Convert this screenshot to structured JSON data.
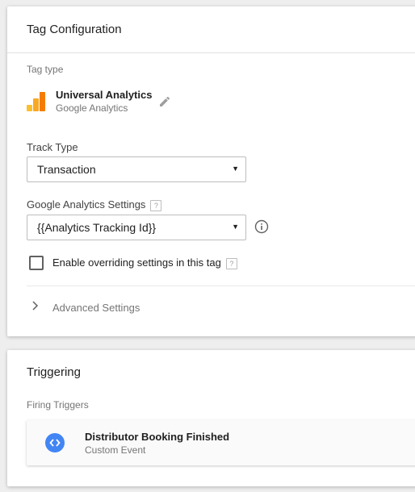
{
  "tag_config": {
    "title": "Tag Configuration",
    "tag_type_label": "Tag type",
    "tag_type": {
      "name": "Universal Analytics",
      "vendor": "Google Analytics",
      "icon": "google-analytics-logo-icon",
      "edit_icon": "pencil-icon"
    },
    "track_type": {
      "label": "Track Type",
      "selected": "Transaction"
    },
    "ga_settings": {
      "label": "Google Analytics Settings",
      "help": "?",
      "selected": "{{Analytics Tracking Id}}",
      "info_icon": "info-icon"
    },
    "override_checkbox": {
      "label": "Enable overriding settings in this tag",
      "help": "?",
      "checked": false
    },
    "advanced": {
      "label": "Advanced Settings",
      "icon": "chevron-right-icon",
      "expanded": false
    }
  },
  "triggering": {
    "title": "Triggering",
    "firing_label": "Firing Triggers",
    "triggers": [
      {
        "name": "Distributor Booking Finished",
        "type": "Custom Event",
        "icon": "custom-event-icon"
      }
    ]
  },
  "colors": {
    "ga_logo": [
      "#fbc02d",
      "#f9a825",
      "#f57c00"
    ],
    "trigger_icon": "#4285f4",
    "background": "#eeeeee"
  }
}
